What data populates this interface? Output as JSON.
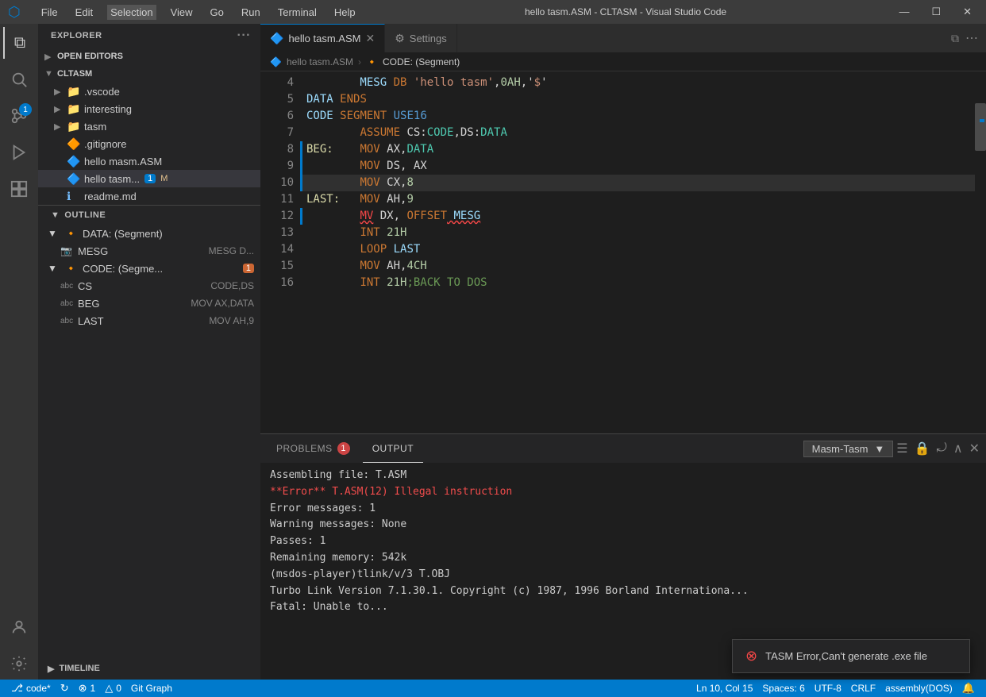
{
  "titlebar": {
    "logo": "⬡",
    "menu": [
      "File",
      "Edit",
      "Selection",
      "View",
      "Go",
      "Run",
      "Terminal",
      "Help"
    ],
    "title": "hello tasm.ASM - CLTASM - Visual Studio Code",
    "controls": [
      "—",
      "☐",
      "✕"
    ]
  },
  "activitybar": {
    "icons": [
      {
        "name": "explorer-icon",
        "symbol": "⧉",
        "active": true
      },
      {
        "name": "search-icon",
        "symbol": "🔍"
      },
      {
        "name": "scm-icon",
        "symbol": "⑃",
        "badge": "1"
      },
      {
        "name": "run-icon",
        "symbol": "▷"
      },
      {
        "name": "extensions-icon",
        "symbol": "⊞"
      }
    ],
    "bottom_icons": [
      {
        "name": "accounts-icon",
        "symbol": "👤"
      },
      {
        "name": "settings-icon",
        "symbol": "⚙"
      }
    ]
  },
  "sidebar": {
    "explorer_header": "EXPLORER",
    "open_editors_label": "OPEN EDITORS",
    "project_label": "CLTASM",
    "tree_items": [
      {
        "indent": 1,
        "type": "folder",
        "label": ".vscode",
        "expanded": false
      },
      {
        "indent": 1,
        "type": "folder",
        "label": "interesting",
        "expanded": false
      },
      {
        "indent": 1,
        "type": "folder",
        "label": "tasm",
        "expanded": false
      },
      {
        "indent": 1,
        "type": "file",
        "label": ".gitignore",
        "icon": "🔶"
      },
      {
        "indent": 1,
        "type": "file",
        "label": "hello masm.ASM",
        "icon": "🔷"
      },
      {
        "indent": 1,
        "type": "file",
        "label": "hello tasm...",
        "icon": "🔷",
        "active": true,
        "badge": "1",
        "modified": "M"
      },
      {
        "indent": 1,
        "type": "file",
        "label": "readme.md",
        "icon": "ℹ"
      }
    ],
    "outline_header": "OUTLINE",
    "outline_items": [
      {
        "indent": 0,
        "expanded": true,
        "icon": "🔸",
        "label": "DATA: (Segment)",
        "detail": ""
      },
      {
        "indent": 1,
        "icon": "📷",
        "label": "MESG",
        "detail": "MESG D..."
      },
      {
        "indent": 0,
        "expanded": true,
        "icon": "🔸",
        "label": "CODE: (Segme...",
        "detail": "",
        "badge": "1"
      },
      {
        "indent": 1,
        "icon": "abc",
        "label": "CS",
        "detail": "CODE,DS"
      },
      {
        "indent": 1,
        "icon": "abc",
        "label": "BEG",
        "detail": "MOV AX,DATA"
      },
      {
        "indent": 1,
        "icon": "abc",
        "label": "LAST",
        "detail": "MOV AH,9"
      }
    ],
    "timeline_label": "TIMELINE"
  },
  "tabs": [
    {
      "label": "hello tasm.ASM",
      "active": true,
      "icon": "🔷",
      "closeable": true
    },
    {
      "label": "Settings",
      "active": false,
      "icon": "⚙",
      "closeable": false
    }
  ],
  "breadcrumb": {
    "file_icon": "🔷",
    "file_label": "hello tasm.ASM",
    "sep": ">",
    "seg_icon": "🔸",
    "seg_label": "CODE: (Segment)"
  },
  "code": {
    "lines": [
      {
        "num": "4",
        "content": "        MESG DB 'hello tasm',0AH,'$'",
        "tokens": [
          {
            "text": "        "
          },
          {
            "text": "MESG",
            "cls": "kw-label"
          },
          {
            "text": " DB ",
            "cls": "kw-orange"
          },
          {
            "text": "'hello tasm'",
            "cls": "kw-string"
          },
          {
            "text": ",",
            "cls": "kw-white"
          },
          {
            "text": "0AH",
            "cls": "kw-number"
          },
          {
            "text": ",'",
            "cls": "kw-white"
          },
          {
            "text": "$",
            "cls": "kw-string"
          },
          {
            "text": "'",
            "cls": "kw-white"
          }
        ]
      },
      {
        "num": "5",
        "content": "DATA ENDS",
        "tokens": [
          {
            "text": "DATA ",
            "cls": "kw-label"
          },
          {
            "text": "ENDS",
            "cls": "kw-orange"
          }
        ]
      },
      {
        "num": "6",
        "content": "CODE SEGMENT USE16",
        "tokens": [
          {
            "text": "CODE ",
            "cls": "kw-label"
          },
          {
            "text": "SEGMENT",
            "cls": "kw-orange"
          },
          {
            "text": " USE16",
            "cls": "kw-blue"
          }
        ]
      },
      {
        "num": "7",
        "content": "        ASSUME CS:CODE,DS:DATA",
        "tokens": [
          {
            "text": "        "
          },
          {
            "text": "ASSUME",
            "cls": "kw-orange"
          },
          {
            "text": " CS:",
            "cls": "kw-white"
          },
          {
            "text": "CODE",
            "cls": "kw-cyan"
          },
          {
            "text": ",DS:",
            "cls": "kw-white"
          },
          {
            "text": "DATA",
            "cls": "kw-cyan"
          }
        ]
      },
      {
        "num": "8",
        "content": "BEG:    MOV AX,DATA",
        "has_indicator": true,
        "tokens": [
          {
            "text": "BEG:",
            "cls": "kw-yellow"
          },
          {
            "text": "    "
          },
          {
            "text": "MOV",
            "cls": "kw-orange"
          },
          {
            "text": " AX,",
            "cls": "kw-white"
          },
          {
            "text": "DATA",
            "cls": "kw-cyan"
          }
        ]
      },
      {
        "num": "9",
        "content": "        MOV DS, AX",
        "has_indicator": true,
        "tokens": [
          {
            "text": "        "
          },
          {
            "text": "MOV",
            "cls": "kw-orange"
          },
          {
            "text": " DS, AX",
            "cls": "kw-white"
          }
        ]
      },
      {
        "num": "10",
        "content": "        MOV CX,8",
        "highlighted": true,
        "has_indicator": true,
        "tokens": [
          {
            "text": "        "
          },
          {
            "text": "MOV",
            "cls": "kw-orange"
          },
          {
            "text": " CX,",
            "cls": "kw-white"
          },
          {
            "text": "8",
            "cls": "kw-number"
          }
        ]
      },
      {
        "num": "11",
        "content": "LAST:   MOV AH,9",
        "tokens": [
          {
            "text": "LAST:",
            "cls": "kw-yellow"
          },
          {
            "text": "   "
          },
          {
            "text": "MOV",
            "cls": "kw-orange"
          },
          {
            "text": " AH,",
            "cls": "kw-white"
          },
          {
            "text": "9",
            "cls": "kw-number"
          }
        ]
      },
      {
        "num": "12",
        "content": "        MV DX, OFFSET MESG",
        "has_indicator": true,
        "squiggle": true,
        "tokens": [
          {
            "text": "        "
          },
          {
            "text": "MV",
            "cls": "kw-red squiggle"
          },
          {
            "text": " DX,",
            "cls": "kw-white"
          },
          {
            "text": " OFFSET",
            "cls": "kw-orange"
          },
          {
            "text": " MESG",
            "cls": "kw-label"
          }
        ]
      },
      {
        "num": "13",
        "content": "        INT 21H",
        "tokens": [
          {
            "text": "        "
          },
          {
            "text": "INT",
            "cls": "kw-orange"
          },
          {
            "text": " 21H",
            "cls": "kw-number"
          }
        ]
      },
      {
        "num": "14",
        "content": "        LOOP LAST",
        "tokens": [
          {
            "text": "        "
          },
          {
            "text": "LOOP",
            "cls": "kw-orange"
          },
          {
            "text": " LAST",
            "cls": "kw-label"
          }
        ]
      },
      {
        "num": "15",
        "content": "        MOV AH,4CH",
        "tokens": [
          {
            "text": "        "
          },
          {
            "text": "MOV",
            "cls": "kw-orange"
          },
          {
            "text": " AH,",
            "cls": "kw-white"
          },
          {
            "text": "4CH",
            "cls": "kw-number"
          }
        ]
      },
      {
        "num": "16",
        "content": "        INT 21H;BACK TO DOS",
        "tokens": [
          {
            "text": "        "
          },
          {
            "text": "INT",
            "cls": "kw-orange"
          },
          {
            "text": " 21H",
            "cls": "kw-number"
          },
          {
            "text": ";BACK TO DOS",
            "cls": "kw-green"
          }
        ]
      }
    ]
  },
  "panel": {
    "tabs": [
      {
        "label": "PROBLEMS",
        "badge": "1",
        "active": false
      },
      {
        "label": "OUTPUT",
        "active": true
      }
    ],
    "dropdown_label": "Masm-Tasm",
    "output_lines": [
      {
        "text": "Assembling file:  T.ASM",
        "cls": "normal-line"
      },
      {
        "text": "**Error** T.ASM(12) Illegal instruction",
        "cls": "err-line"
      },
      {
        "text": "Error messages:    1",
        "cls": "normal-line"
      },
      {
        "text": "Warning messages:  None",
        "cls": "normal-line"
      },
      {
        "text": "Passes:            1",
        "cls": "normal-line"
      },
      {
        "text": "Remaining memory:  542k",
        "cls": "normal-line"
      },
      {
        "text": "(msdos-player)tlink/v/3 T.OBJ",
        "cls": "normal-line"
      },
      {
        "text": "Turbo Link  Version 7.1.30.1. Copyright (c) 1987, 1996 Borland Internationa...",
        "cls": "normal-line"
      },
      {
        "text": "Fatal: Unable to...",
        "cls": "normal-line"
      }
    ]
  },
  "notification": {
    "icon": "⊗",
    "text": "TASM Error,Can't generate .exe file"
  },
  "statusbar": {
    "left_items": [
      {
        "icon": "⎇",
        "label": "code*"
      },
      {
        "icon": "↻",
        "label": ""
      },
      {
        "icon": "⊗",
        "label": "1"
      },
      {
        "icon": "△",
        "label": "0"
      },
      {
        "label": "Git Graph"
      }
    ],
    "right_items": [
      {
        "label": "Ln 10, Col 15"
      },
      {
        "label": "Spaces: 6"
      },
      {
        "label": "UTF-8"
      },
      {
        "label": "CRLF"
      },
      {
        "label": "assembly(DOS)"
      },
      {
        "icon": "🔔"
      }
    ]
  }
}
